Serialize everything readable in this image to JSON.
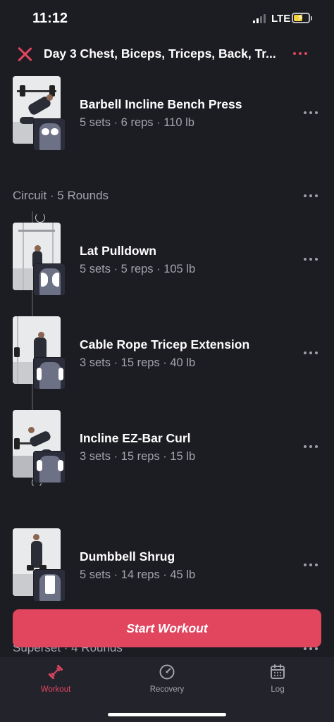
{
  "status_bar": {
    "time": "11:12",
    "network": "LTE"
  },
  "header": {
    "title": "Day 3 Chest, Biceps, Triceps, Back, Tr..."
  },
  "exercises_top": [
    {
      "name": "Barbell Incline Bench Press",
      "meta": "5 sets · 6 reps · 110 lb"
    }
  ],
  "circuit": {
    "label": "Circuit · 5 Rounds",
    "exercises": [
      {
        "name": "Lat Pulldown",
        "meta": "5 sets · 5 reps · 105 lb"
      },
      {
        "name": "Cable Rope Tricep Extension",
        "meta": "3 sets · 15 reps · 40 lb"
      },
      {
        "name": "Incline EZ-Bar Curl",
        "meta": "3 sets · 15 reps · 15 lb"
      }
    ]
  },
  "exercises_bottom": [
    {
      "name": "Dumbbell Shrug",
      "meta": "5 sets · 14 reps · 45 lb"
    }
  ],
  "superset": {
    "label": "Superset · 4 Rounds"
  },
  "start_button": {
    "label": "Start Workout"
  },
  "tabs": [
    {
      "label": "Workout",
      "icon": "dumbbell-icon",
      "active": true
    },
    {
      "label": "Recovery",
      "icon": "recovery-gauge-icon",
      "active": false
    },
    {
      "label": "Log",
      "icon": "calendar-icon",
      "active": false
    }
  ],
  "colors": {
    "accent": "#e2455e",
    "background": "#1c1c23",
    "tabbar": "#23232c"
  }
}
